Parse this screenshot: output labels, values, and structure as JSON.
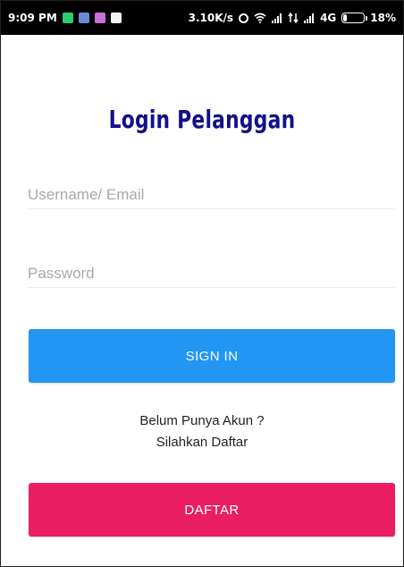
{
  "status_bar": {
    "time": "9:09 PM",
    "network_speed": "3.10K/s",
    "network_type": "4G",
    "battery": "18%",
    "notification_icons": [
      "messaging-icon",
      "mail-icon",
      "gallery-icon",
      "app-icon"
    ],
    "status_icons": [
      "alarm-icon",
      "wifi-icon",
      "signal-icon",
      "data-arrows-icon",
      "signal-icon",
      "battery-icon"
    ]
  },
  "login": {
    "title": "Login Pelanggan",
    "username_placeholder": "Username/ Email",
    "password_placeholder": "Password",
    "sign_in_label": "SIGN IN",
    "register_prompt_line1": "Belum Punya Akun ?",
    "register_prompt_line2": "Silahkan Daftar",
    "daftar_label": "DAFTAR"
  },
  "colors": {
    "title": "#12108a",
    "sign_in_button": "#2196f3",
    "daftar_button": "#e91e63",
    "status_bar": "#000000"
  }
}
